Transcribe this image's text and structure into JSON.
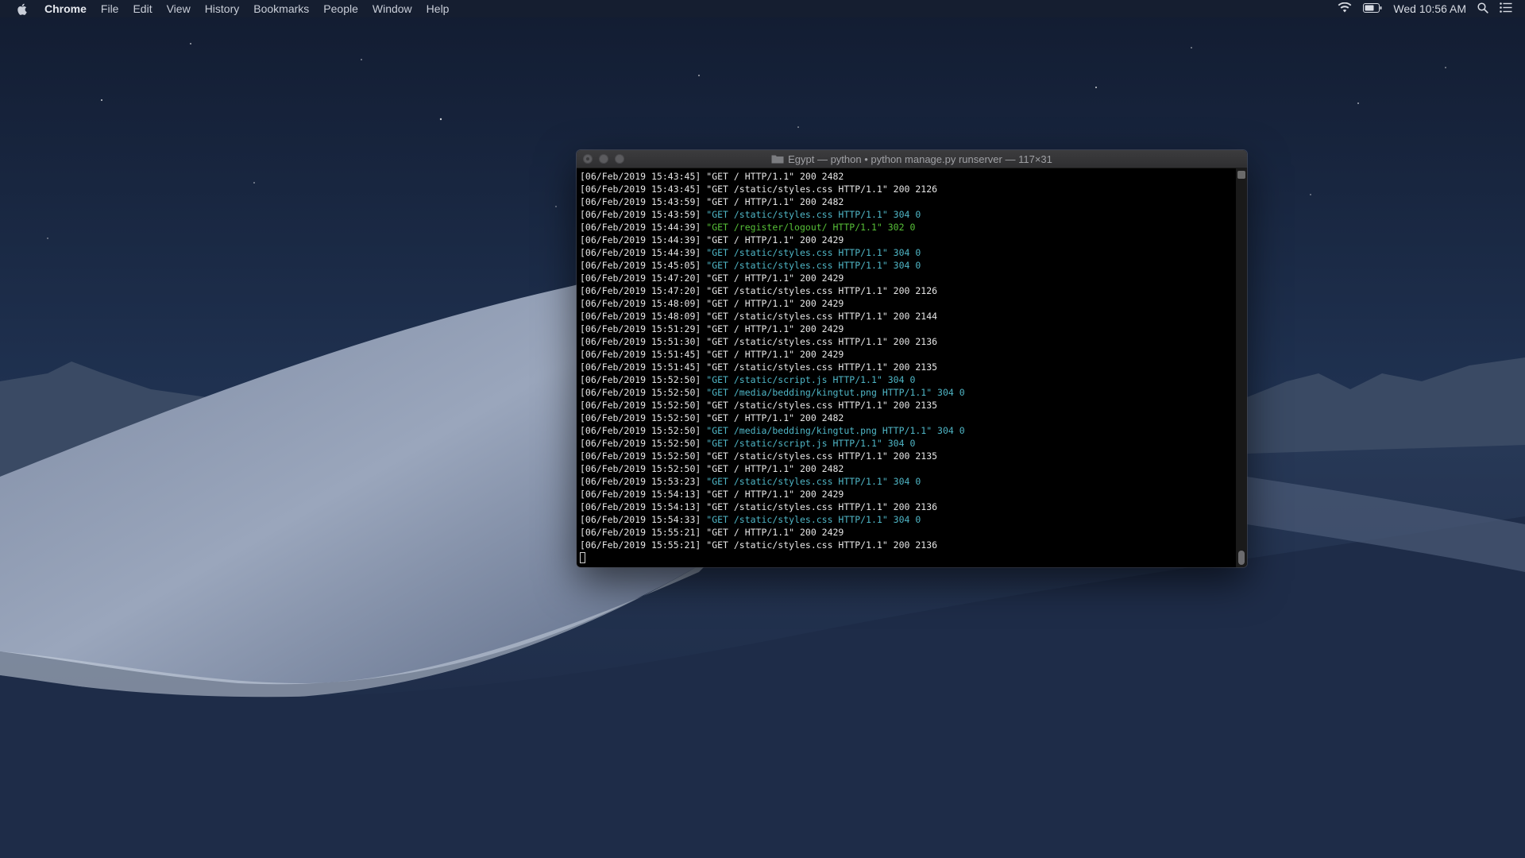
{
  "menubar": {
    "app_name": "Chrome",
    "items": [
      "File",
      "Edit",
      "View",
      "History",
      "Bookmarks",
      "People",
      "Window",
      "Help"
    ],
    "clock": "Wed 10:56 AM",
    "status_icons": [
      "wifi-icon",
      "battery-icon",
      "spotlight-icon",
      "notification-center-icon"
    ]
  },
  "terminal": {
    "title": "Egypt — python • python manage.py runserver — 117×31",
    "colors": {
      "cyan": "#4fb6c6",
      "green": "#57c038",
      "text": "#e6e6e6"
    },
    "lines": [
      {
        "ts": "[06/Feb/2019 15:43:45]",
        "req": "\"GET / HTTP/1.1\" 200 2482",
        "color": "default"
      },
      {
        "ts": "[06/Feb/2019 15:43:45]",
        "req": "\"GET /static/styles.css HTTP/1.1\" 200 2126",
        "color": "default"
      },
      {
        "ts": "[06/Feb/2019 15:43:59]",
        "req": "\"GET / HTTP/1.1\" 200 2482",
        "color": "default"
      },
      {
        "ts": "[06/Feb/2019 15:43:59]",
        "req": "\"GET /static/styles.css HTTP/1.1\" 304 0",
        "color": "cyan"
      },
      {
        "ts": "[06/Feb/2019 15:44:39]",
        "req": "\"GET /register/logout/ HTTP/1.1\" 302 0",
        "color": "green"
      },
      {
        "ts": "[06/Feb/2019 15:44:39]",
        "req": "\"GET / HTTP/1.1\" 200 2429",
        "color": "default"
      },
      {
        "ts": "[06/Feb/2019 15:44:39]",
        "req": "\"GET /static/styles.css HTTP/1.1\" 304 0",
        "color": "cyan"
      },
      {
        "ts": "[06/Feb/2019 15:45:05]",
        "req": "\"GET /static/styles.css HTTP/1.1\" 304 0",
        "color": "cyan"
      },
      {
        "ts": "[06/Feb/2019 15:47:20]",
        "req": "\"GET / HTTP/1.1\" 200 2429",
        "color": "default"
      },
      {
        "ts": "[06/Feb/2019 15:47:20]",
        "req": "\"GET /static/styles.css HTTP/1.1\" 200 2126",
        "color": "default"
      },
      {
        "ts": "[06/Feb/2019 15:48:09]",
        "req": "\"GET / HTTP/1.1\" 200 2429",
        "color": "default"
      },
      {
        "ts": "[06/Feb/2019 15:48:09]",
        "req": "\"GET /static/styles.css HTTP/1.1\" 200 2144",
        "color": "default"
      },
      {
        "ts": "[06/Feb/2019 15:51:29]",
        "req": "\"GET / HTTP/1.1\" 200 2429",
        "color": "default"
      },
      {
        "ts": "[06/Feb/2019 15:51:30]",
        "req": "\"GET /static/styles.css HTTP/1.1\" 200 2136",
        "color": "default"
      },
      {
        "ts": "[06/Feb/2019 15:51:45]",
        "req": "\"GET / HTTP/1.1\" 200 2429",
        "color": "default"
      },
      {
        "ts": "[06/Feb/2019 15:51:45]",
        "req": "\"GET /static/styles.css HTTP/1.1\" 200 2135",
        "color": "default"
      },
      {
        "ts": "[06/Feb/2019 15:52:50]",
        "req": "\"GET /static/script.js HTTP/1.1\" 304 0",
        "color": "cyan"
      },
      {
        "ts": "[06/Feb/2019 15:52:50]",
        "req": "\"GET /media/bedding/kingtut.png HTTP/1.1\" 304 0",
        "color": "cyan"
      },
      {
        "ts": "[06/Feb/2019 15:52:50]",
        "req": "\"GET /static/styles.css HTTP/1.1\" 200 2135",
        "color": "default"
      },
      {
        "ts": "[06/Feb/2019 15:52:50]",
        "req": "\"GET / HTTP/1.1\" 200 2482",
        "color": "default"
      },
      {
        "ts": "[06/Feb/2019 15:52:50]",
        "req": "\"GET /media/bedding/kingtut.png HTTP/1.1\" 304 0",
        "color": "cyan"
      },
      {
        "ts": "[06/Feb/2019 15:52:50]",
        "req": "\"GET /static/script.js HTTP/1.1\" 304 0",
        "color": "cyan"
      },
      {
        "ts": "[06/Feb/2019 15:52:50]",
        "req": "\"GET /static/styles.css HTTP/1.1\" 200 2135",
        "color": "default"
      },
      {
        "ts": "[06/Feb/2019 15:52:50]",
        "req": "\"GET / HTTP/1.1\" 200 2482",
        "color": "default"
      },
      {
        "ts": "[06/Feb/2019 15:53:23]",
        "req": "\"GET /static/styles.css HTTP/1.1\" 304 0",
        "color": "cyan"
      },
      {
        "ts": "[06/Feb/2019 15:54:13]",
        "req": "\"GET / HTTP/1.1\" 200 2429",
        "color": "default"
      },
      {
        "ts": "[06/Feb/2019 15:54:13]",
        "req": "\"GET /static/styles.css HTTP/1.1\" 200 2136",
        "color": "default"
      },
      {
        "ts": "[06/Feb/2019 15:54:33]",
        "req": "\"GET /static/styles.css HTTP/1.1\" 304 0",
        "color": "cyan"
      },
      {
        "ts": "[06/Feb/2019 15:55:21]",
        "req": "\"GET / HTTP/1.1\" 200 2429",
        "color": "default"
      },
      {
        "ts": "[06/Feb/2019 15:55:21]",
        "req": "\"GET /static/styles.css HTTP/1.1\" 200 2136",
        "color": "default"
      }
    ]
  }
}
